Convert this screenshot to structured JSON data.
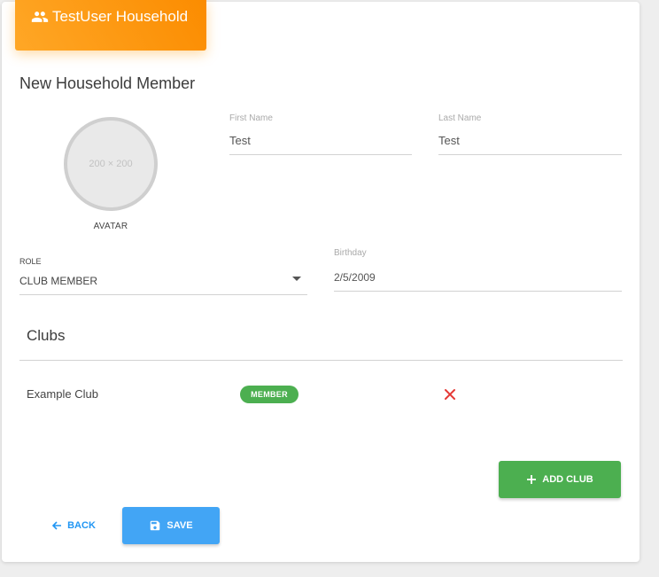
{
  "header": {
    "title": "TestUser Household",
    "icon": "people-icon"
  },
  "form": {
    "title": "New Household Member",
    "avatar": {
      "placeholder": "200 × 200",
      "label": "AVATAR"
    },
    "first_name": {
      "label": "First Name",
      "value": "Test"
    },
    "last_name": {
      "label": "Last Name",
      "value": "Test"
    },
    "role": {
      "label": "ROLE",
      "value": "CLUB MEMBER"
    },
    "birthday": {
      "label": "Birthday",
      "value": "2/5/2009"
    }
  },
  "clubs": {
    "title": "Clubs",
    "items": [
      {
        "name": "Example Club",
        "badge": "MEMBER",
        "badge_color": "#4caf50",
        "remove_icon": "close-icon",
        "remove_color": "#e53935"
      }
    ],
    "add_label": "ADD CLUB"
  },
  "actions": {
    "back_label": "BACK",
    "save_label": "SAVE"
  },
  "colors": {
    "header": "#fb8c00",
    "primary": "#42a5f5",
    "success": "#4caf50"
  }
}
